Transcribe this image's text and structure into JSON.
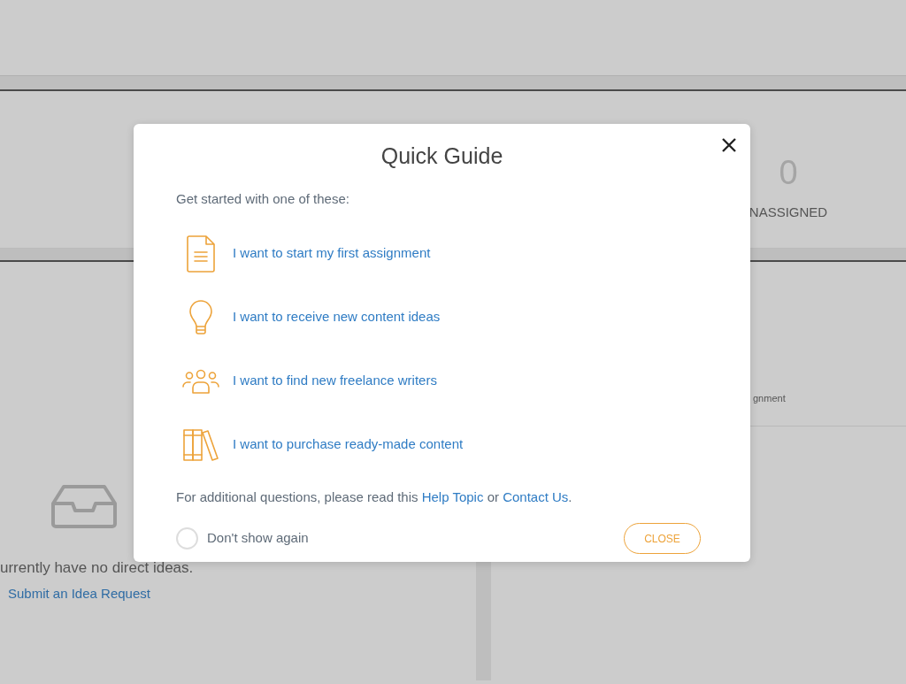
{
  "background": {
    "stats": [
      {
        "value": "0",
        "label": "NASSIGNED"
      }
    ],
    "ideas_panel": {
      "empty_message": "urrently have no direct ideas.",
      "link": "Submit an Idea Request"
    },
    "right_panel": {
      "text": "gnment"
    }
  },
  "dialog": {
    "title": "Quick Guide",
    "intro": "Get started with one of these:",
    "options": [
      {
        "kind": "document",
        "label": "I want to start my first assignment"
      },
      {
        "kind": "lightbulb",
        "label": "I want to receive new content ideas"
      },
      {
        "kind": "people",
        "label": "I want to find new freelance writers"
      },
      {
        "kind": "books",
        "label": "I want to purchase ready-made content"
      }
    ],
    "footer": {
      "before": "For additional questions, please read this",
      "link_1": "Help Topic",
      "middle": "or",
      "link_2": "Contact Us",
      "after": "."
    },
    "dont_show_again": {
      "label": "Don't show again",
      "checked": false
    },
    "close_button": "CLOSE"
  }
}
